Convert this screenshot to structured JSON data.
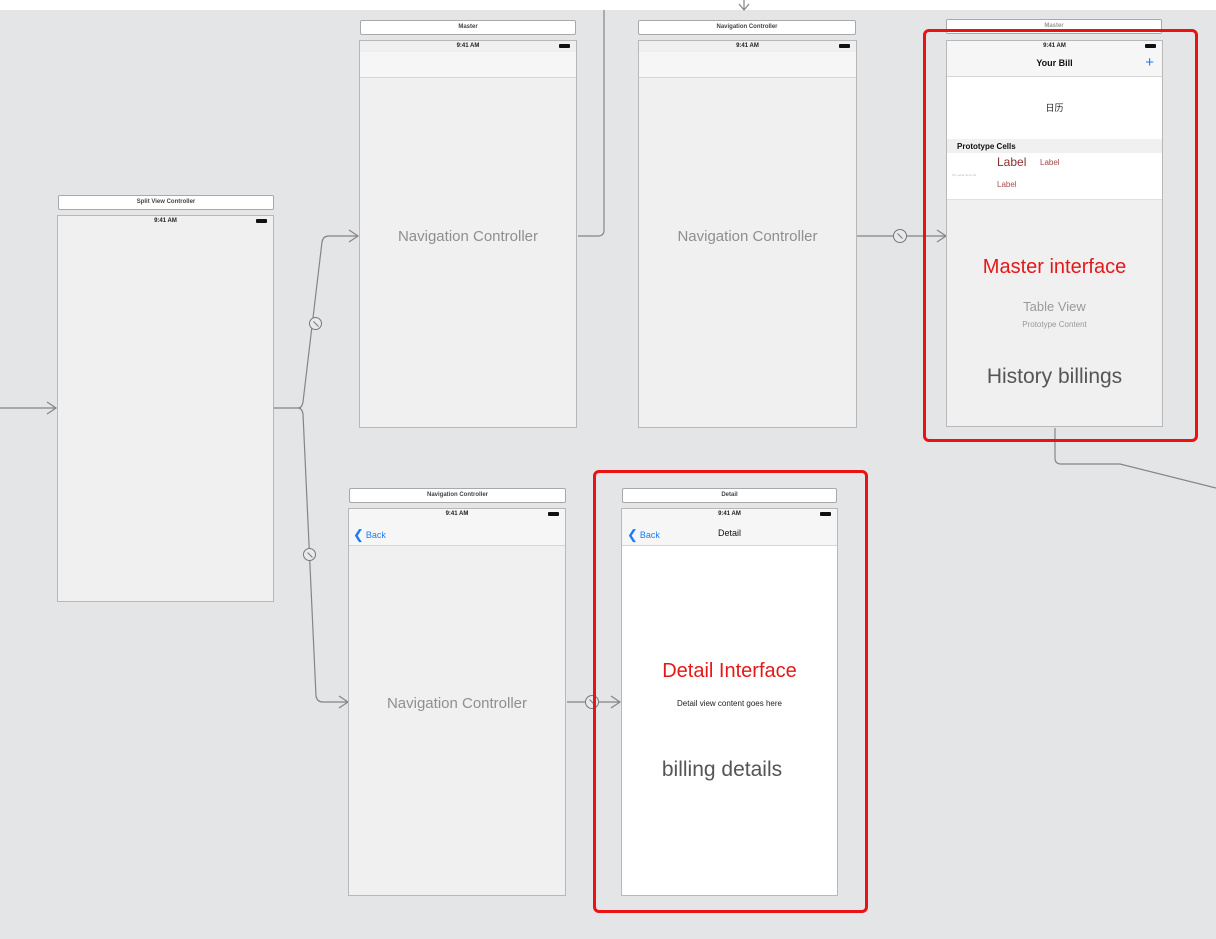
{
  "status_time": "9:41 AM",
  "split": {
    "title": "Split View Controller"
  },
  "master_nav": {
    "title": "Master",
    "body": "Navigation Controller"
  },
  "top_nav": {
    "title": "Navigation Controller",
    "body": "Navigation Controller"
  },
  "master_scene": {
    "title": "Master",
    "nav_title": "Your Bill",
    "plus": "+",
    "header_text": "日历",
    "section_header": "Prototype Cells",
    "cell_label_large": "Label",
    "cell_label_right": "Label",
    "cell_label_small": "Label",
    "cell_tiny": "My Label Here Ok",
    "table_view": "Table View",
    "prototype_content": "Prototype Content"
  },
  "bottom_nav": {
    "title": "Navigation Controller",
    "back": "Back",
    "body": "Navigation Controller"
  },
  "detail_scene": {
    "title": "Detail",
    "back": "Back",
    "nav_title": "Detail",
    "content": "Detail view content goes here"
  },
  "annotations": {
    "master_interface": "Master interface",
    "history": "History billings",
    "detail_interface": "Detail Interface",
    "billing": "billing details"
  },
  "colors": {
    "annotation": "#ea1212",
    "ios_blue": "#1a7cf5",
    "canvas": "#e4e5e7"
  }
}
